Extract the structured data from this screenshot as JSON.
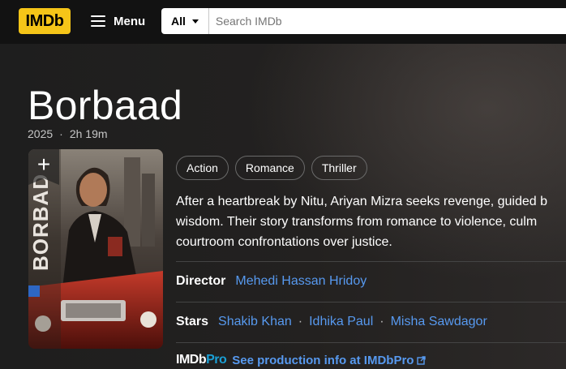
{
  "header": {
    "logo": "IMDb",
    "menu_label": "Menu",
    "search": {
      "category": "All",
      "placeholder": "Search IMDb"
    }
  },
  "title": {
    "name": "Borbaad",
    "year": "2025",
    "runtime": "2h 19m"
  },
  "poster": {
    "add_symbol": "+"
  },
  "genres": [
    "Action",
    "Romance",
    "Thriller"
  ],
  "plot_lines": [
    "After a heartbreak by Nitu, Ariyan Mizra seeks revenge, guided b",
    "wisdom. Their story transforms from romance to violence, culm",
    "courtroom confrontations over justice."
  ],
  "director": {
    "label": "Director",
    "names": [
      "Mehedi Hassan Hridoy"
    ]
  },
  "stars": {
    "label": "Stars",
    "names": [
      "Shakib Khan",
      "Idhika Paul",
      "Misha Sawdagor"
    ]
  },
  "imdbpro": {
    "logo_imdb": "IMDb",
    "logo_pro": "Pro",
    "link_text": "See production info at IMDbPro"
  },
  "colors": {
    "logo_yellow": "#f5c518",
    "link_blue": "#5799ef",
    "pro_blue": "#1a9fd5"
  }
}
